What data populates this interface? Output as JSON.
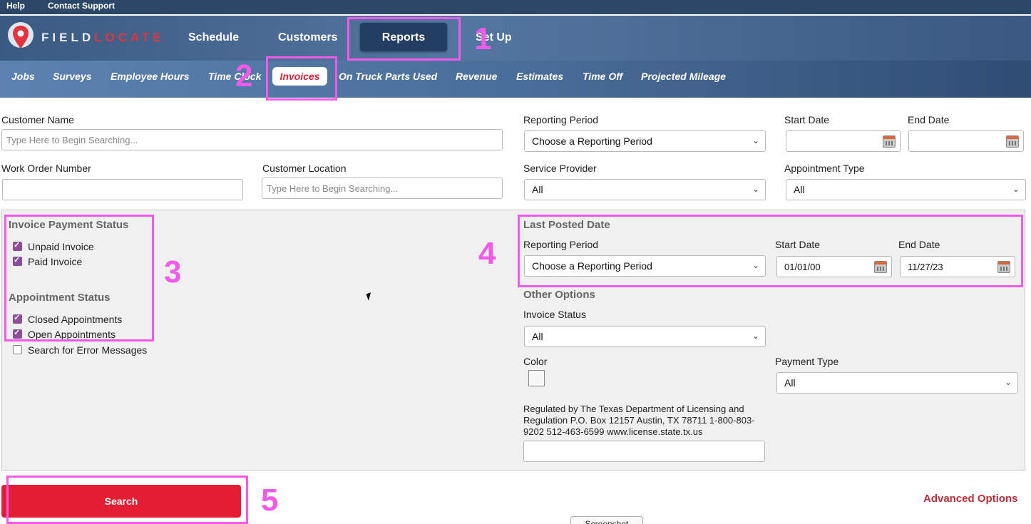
{
  "topbar": {
    "help": "Help",
    "contact": "Contact Support"
  },
  "logo": {
    "part1": "FIELD",
    "part2": "LOCATE"
  },
  "nav": {
    "schedule": "Schedule",
    "customers": "Customers",
    "reports": "Reports",
    "setup": "Set Up"
  },
  "subnav": {
    "jobs": "Jobs",
    "surveys": "Surveys",
    "employee_hours": "Employee Hours",
    "time_clock": "Time Clock",
    "invoices": "Invoices",
    "on_truck": "On Truck Parts Used",
    "revenue": "Revenue",
    "estimates": "Estimates",
    "time_off": "Time Off",
    "projected_mileage": "Projected Mileage"
  },
  "filters": {
    "customer_name_label": "Customer Name",
    "customer_name_placeholder": "Type Here to Begin Searching...",
    "reporting_period_label": "Reporting Period",
    "reporting_period_value": "Choose a Reporting Period",
    "start_date_label": "Start Date",
    "end_date_label": "End Date",
    "work_order_label": "Work Order Number",
    "customer_location_label": "Customer Location",
    "customer_location_placeholder": "Type Here to Begin Searching...",
    "service_provider_label": "Service Provider",
    "service_provider_value": "All",
    "appointment_type_label": "Appointment Type",
    "appointment_type_value": "All"
  },
  "invoice_payment": {
    "title": "Invoice Payment Status",
    "unpaid": "Unpaid Invoice",
    "paid": "Paid Invoice"
  },
  "appointment_status": {
    "title": "Appointment Status",
    "closed": "Closed Appointments",
    "open": "Open Appointments",
    "errors": "Search for Error Messages"
  },
  "last_posted": {
    "title": "Last Posted Date",
    "reporting_period_label": "Reporting Period",
    "reporting_period_value": "Choose a Reporting Period",
    "start_date_label": "Start Date",
    "start_date_value": "01/01/00",
    "end_date_label": "End Date",
    "end_date_value": "11/27/23"
  },
  "other_options": {
    "title": "Other Options",
    "invoice_status_label": "Invoice Status",
    "invoice_status_value": "All",
    "color_label": "Color",
    "payment_type_label": "Payment Type",
    "payment_type_value": "All",
    "regulation_text": "Regulated by The Texas Department of Licensing and Regulation P.O. Box 12157 Austin, TX 78711 1-800-803-9202 512-463-6599 www.license.state.tx.us"
  },
  "actions": {
    "search": "Search",
    "advanced": "Advanced Options",
    "screenshot": "Screenshot"
  },
  "annotations": {
    "n1": "1",
    "n2": "2",
    "n3": "3",
    "n4": "4",
    "n5": "5"
  },
  "colors": {
    "accent": "#e41d32",
    "highlight": "#f25ae8",
    "nav": "#3b5a82",
    "checkbox": "#8a4f96"
  }
}
